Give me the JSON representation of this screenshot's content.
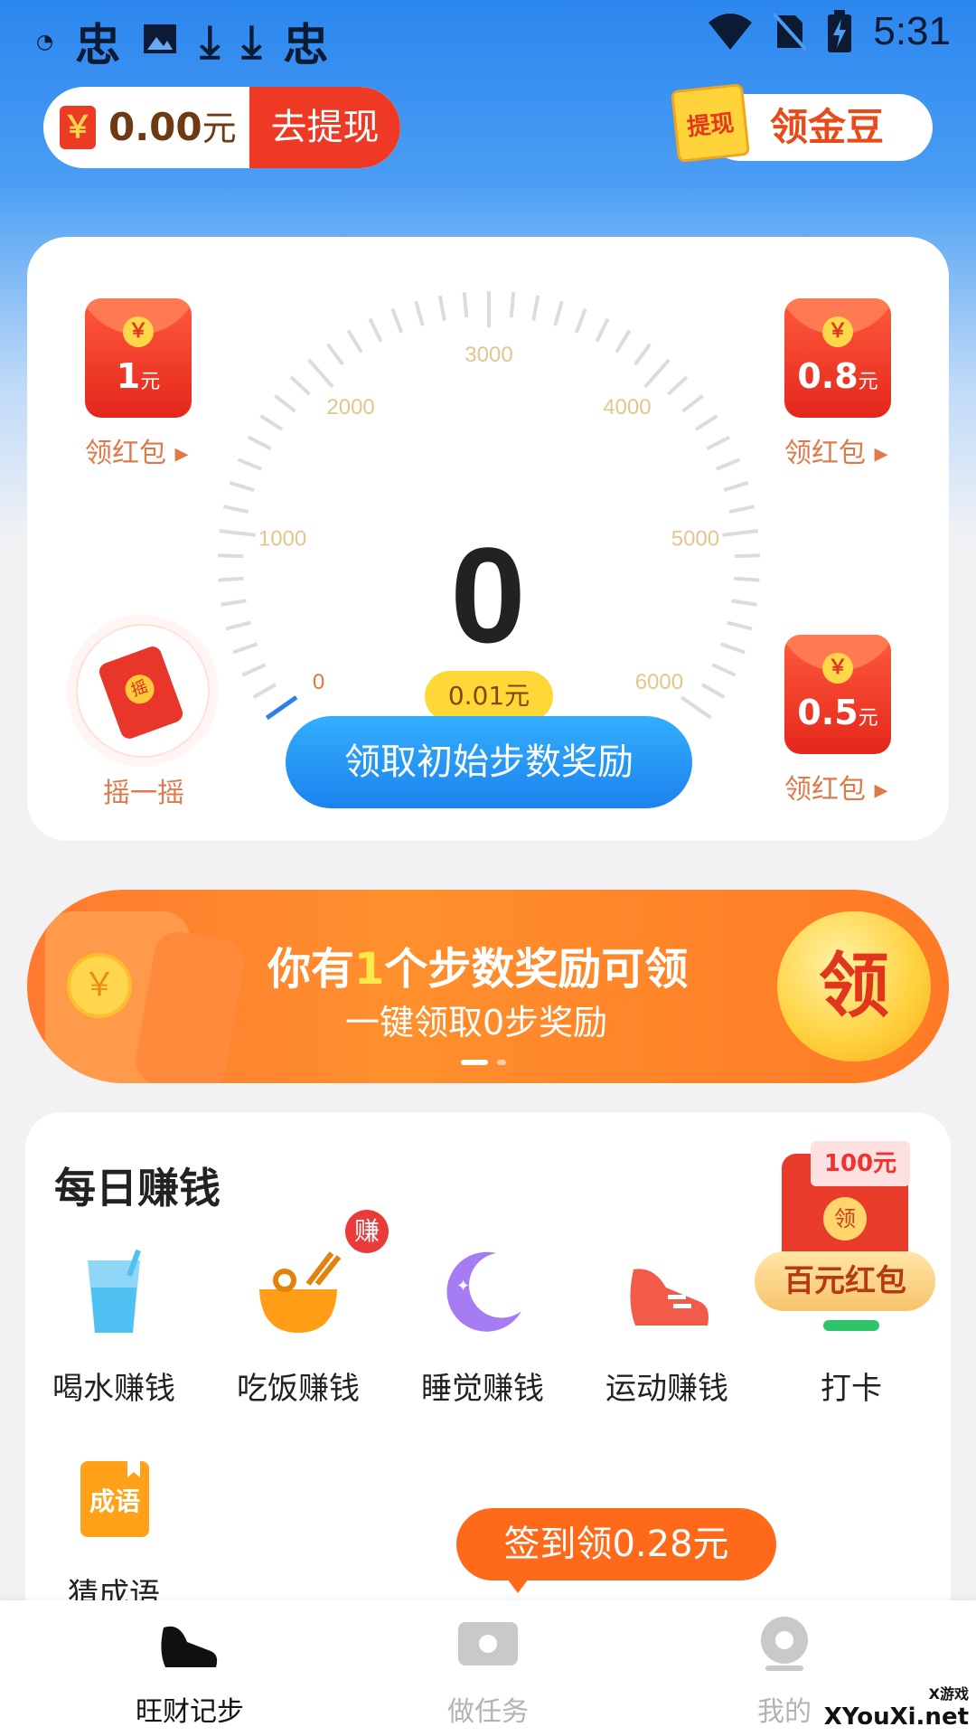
{
  "status_bar": {
    "time": "5:31"
  },
  "header": {
    "wallet_amount": "0.00",
    "wallet_unit": "元",
    "wallet_currency_icon": "￥",
    "withdraw_label": "去提现",
    "beans_badge": "提现",
    "beans_label": "领金豆"
  },
  "gauge": {
    "steps": "0",
    "ticks": [
      "0",
      "1000",
      "2000",
      "3000",
      "4000",
      "5000",
      "6000"
    ],
    "reward_tip": "0.01元",
    "claim_button": "领取初始步数奖励"
  },
  "redpacks": [
    {
      "value": "1",
      "unit": "元",
      "label": "领红包"
    },
    {
      "value": "0.8",
      "unit": "元",
      "label": "领红包"
    },
    {
      "value": "0.5",
      "unit": "元",
      "label": "领红包"
    }
  ],
  "shake": {
    "badge": "摇",
    "label": "摇一摇"
  },
  "banner": {
    "title_pre": "你有",
    "title_count": "1",
    "title_post": "个步数奖励可领",
    "subtitle": "一键领取0步奖励",
    "claim": "领",
    "coin": "￥"
  },
  "daily": {
    "title": "每日赚钱",
    "earn_badge": "赚",
    "tasks": [
      {
        "label": "喝水赚钱",
        "icon": "water-glass-icon"
      },
      {
        "label": "吃饭赚钱",
        "icon": "rice-bowl-icon"
      },
      {
        "label": "睡觉赚钱",
        "icon": "moon-icon"
      },
      {
        "label": "运动赚钱",
        "icon": "sneaker-icon"
      },
      {
        "label": "打卡",
        "icon": "checkin-icon"
      },
      {
        "label": "猜成语",
        "icon": "idiom-book-icon"
      }
    ],
    "idiom_icon_text": "成语",
    "hundred": {
      "note": "100元",
      "seal": "领",
      "pill": "百元红包"
    },
    "checkin_bubble": "签到领0.28元"
  },
  "bottom_nav": [
    {
      "label": "旺财记步",
      "active": true
    },
    {
      "label": "做任务",
      "active": false
    },
    {
      "label": "我的",
      "active": false
    }
  ],
  "watermark": {
    "text": "XYouXi.net",
    "small": "X游戏"
  },
  "colors": {
    "primary_blue": "#2b86ee",
    "red": "#ee3a24",
    "orange": "#ff7a30",
    "gold": "#ffd837"
  }
}
